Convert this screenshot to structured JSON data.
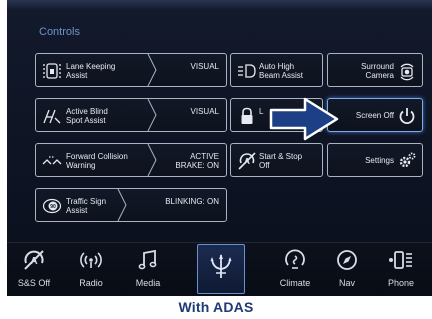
{
  "section_title": "Controls",
  "tiles": {
    "lane_keeping": {
      "label": "Lane Keeping\nAssist",
      "value": "VISUAL",
      "icon": "lane-keeping-icon"
    },
    "blind_spot": {
      "label": "Active Blind\nSpot Assist",
      "value": "VISUAL",
      "icon": "blind-spot-icon"
    },
    "forward_collision": {
      "label": "Forward Collision\nWarning",
      "value": "ACTIVE\nBRAKE: ON",
      "icon": "forward-collision-icon"
    },
    "traffic_sign": {
      "label": "Traffic Sign\nAssist",
      "value": "BLINKING: ON",
      "icon": "speed-sign-icon"
    },
    "auto_high_beam": {
      "label": "Auto High\nBeam Assist",
      "icon": "high-beam-icon"
    },
    "lock": {
      "label": "L",
      "icon": "lock-icon"
    },
    "start_stop": {
      "label": "Start & Stop\nOff",
      "icon": "start-stop-off-icon"
    },
    "surround_camera": {
      "label": "Surround\nCamera",
      "icon": "camera-icon"
    },
    "screen_off": {
      "label": "Screen Off",
      "icon": "power-icon"
    },
    "settings": {
      "label": "Settings",
      "icon": "gears-icon"
    }
  },
  "bottom_nav": [
    {
      "label": "S&S Off",
      "icon": "start-stop-off-icon"
    },
    {
      "label": "Radio",
      "icon": "radio-icon"
    },
    {
      "label": "Media",
      "icon": "music-note-icon"
    },
    {
      "label": "",
      "icon": "trident-logo-icon"
    },
    {
      "label": "Climate",
      "icon": "climate-icon"
    },
    {
      "label": "Nav",
      "icon": "compass-icon"
    },
    {
      "label": "Phone",
      "icon": "phone-icon"
    }
  ],
  "caption": "With ADAS",
  "colors": {
    "title": "#6e93c8",
    "accent": "#7fa9e8",
    "arrow_fill": "#1d3f86",
    "caption": "#1f3a75"
  }
}
